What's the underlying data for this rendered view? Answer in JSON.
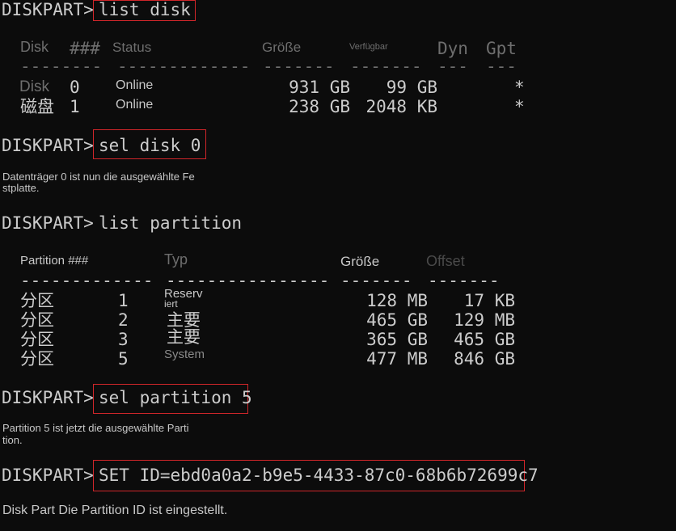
{
  "prompt": "DISKPART>",
  "commands": {
    "list_disk": "list disk",
    "sel_disk": "sel disk 0",
    "list_partition": "list partition",
    "sel_partition": "sel partition 5",
    "set_id": "SET ID=ebd0a0a2-b9e5-4433-87c0-68b6b72699c7"
  },
  "disk_table": {
    "headers": [
      "Disk",
      "###",
      "Status",
      "Größe",
      "Verfügbar",
      "Dyn",
      "Gpt"
    ],
    "separators": [
      "--------",
      "-------------",
      "-------",
      "-------",
      "---",
      "---"
    ],
    "rows": [
      {
        "label": "Disk",
        "num": "0",
        "status": "Online",
        "size": "931 GB",
        "free": "99 GB",
        "dyn": "",
        "gpt": "*"
      },
      {
        "label": "磁盘",
        "num": "1",
        "status": "Online",
        "size": "238 GB",
        "free": "2048 KB",
        "dyn": "",
        "gpt": "*"
      }
    ]
  },
  "messages": {
    "disk_selected_line1": "Datenträger 0 ist nun die ausgewählte Fe",
    "disk_selected_line2": "stplatte.",
    "partition_selected_line1": "Partition 5 ist jetzt die ausgewählte Parti",
    "partition_selected_line2": "tion.",
    "id_set": "Disk Part Die Partition ID ist eingestellt."
  },
  "partition_table": {
    "headers": [
      "Partition ###",
      "Typ",
      "Größe",
      "Offset"
    ],
    "separators": [
      "-------------",
      "----------------",
      "-------",
      "-------"
    ],
    "rows": [
      {
        "label": "分区",
        "num": "1",
        "type_line1": "Reserv",
        "type_line2": "iert",
        "size": "128 MB",
        "offset": "17 KB"
      },
      {
        "label": "分区",
        "num": "2",
        "type_line1": "主要",
        "type_line2": "",
        "size": "465 GB",
        "offset": "129 MB"
      },
      {
        "label": "分区",
        "num": "3",
        "type_line1": "主要",
        "type_line2": "",
        "size": "365 GB",
        "offset": "465 GB"
      },
      {
        "label": "分区",
        "num": "5",
        "type_line1": "System",
        "type_line2": "",
        "size": "477 MB",
        "offset": "846 GB"
      }
    ]
  },
  "colors": {
    "background": "#0c0c0c",
    "text": "#cccccc",
    "highlight_box": "#d0262a"
  }
}
